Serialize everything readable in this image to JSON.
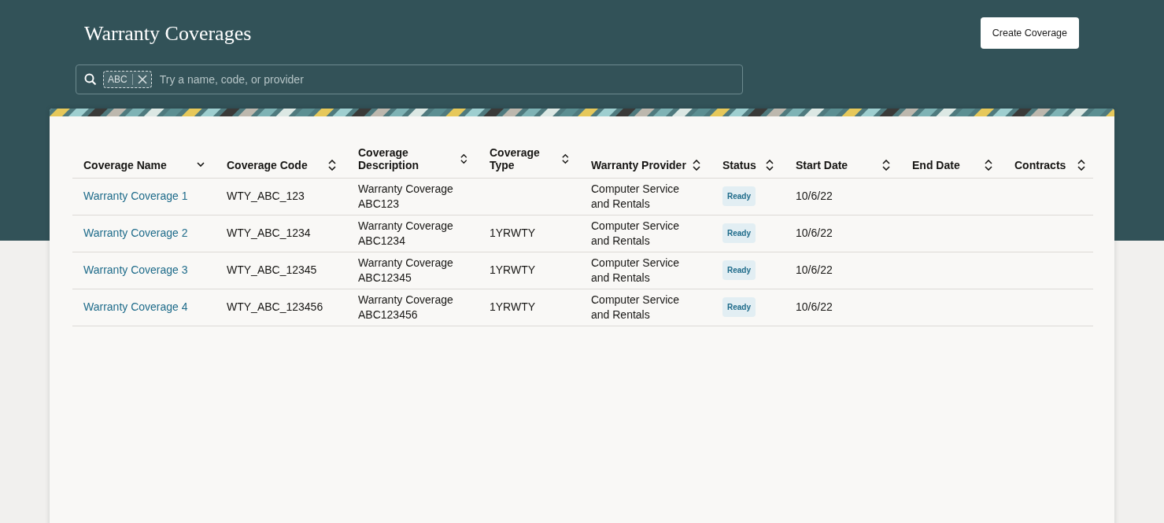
{
  "header": {
    "title": "Warranty Coverages",
    "create_button": "Create Coverage"
  },
  "search": {
    "chips": [
      {
        "label": "ABC"
      }
    ],
    "placeholder": "Try a name, code, or provider"
  },
  "table": {
    "columns": [
      {
        "label": "Coverage Name",
        "sorted": true
      },
      {
        "label": "Coverage Code",
        "sorted": false
      },
      {
        "label": "Coverage Description",
        "sorted": false
      },
      {
        "label": "Coverage Type",
        "sorted": false
      },
      {
        "label": "Warranty Provider",
        "sorted": false
      },
      {
        "label": "Status",
        "sorted": false
      },
      {
        "label": "Start Date",
        "sorted": false
      },
      {
        "label": "End Date",
        "sorted": false
      },
      {
        "label": "Contracts",
        "sorted": false
      }
    ],
    "rows": [
      {
        "name": "Warranty Coverage 1",
        "code": "WTY_ABC_123",
        "description": "Warranty Coverage ABC123",
        "provider": "Computer Service and Rentals",
        "status": "Ready",
        "start_date": "10/6/22"
      },
      {
        "name": "Warranty Coverage 2",
        "code": "WTY_ABC_1234",
        "description": "Warranty Coverage ABC1234",
        "type": "1YRWTY",
        "provider": "Computer Service and Rentals",
        "status": "Ready",
        "start_date": "10/6/22"
      },
      {
        "name": "Warranty Coverage 3",
        "code": "WTY_ABC_12345",
        "description": "Warranty Coverage ABC12345",
        "type": "1YRWTY",
        "provider": "Computer Service and Rentals",
        "status": "Ready",
        "start_date": "10/6/22"
      },
      {
        "name": "Warranty Coverage 4",
        "code": "WTY_ABC_123456",
        "description": "Warranty Coverage ABC123456",
        "type": "1YRWTY",
        "provider": "Computer Service and Rentals",
        "status": "Ready",
        "start_date": "10/6/22"
      }
    ]
  }
}
